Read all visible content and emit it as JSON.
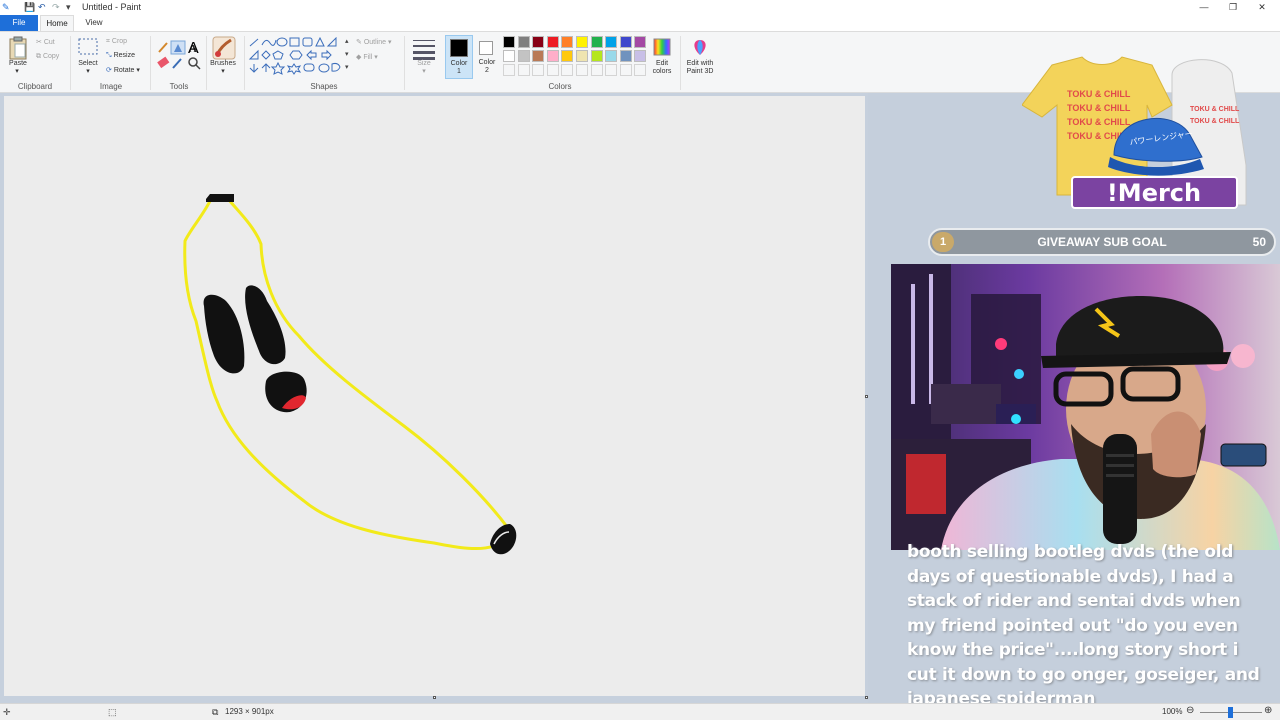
{
  "window": {
    "title": "Untitled - Paint",
    "controls": {
      "minimize": "—",
      "restore": "❐",
      "close": "✕"
    }
  },
  "menu": {
    "tabs": [
      "File",
      "Home",
      "View"
    ]
  },
  "ribbon": {
    "clipboard": {
      "label": "Clipboard",
      "paste": "Paste",
      "cut": "Cut",
      "copy": "Copy"
    },
    "image": {
      "label": "Image",
      "select": "Select",
      "crop": "Crop",
      "resize": "Resize",
      "rotate": "Rotate"
    },
    "tools": {
      "label": "Tools",
      "text_tool": "A"
    },
    "brushes": {
      "label": "Brushes"
    },
    "shapes": {
      "label": "Shapes",
      "outline": "Outline",
      "fill": "Fill"
    },
    "size": {
      "label": "Size"
    },
    "color1": {
      "label_a": "Color",
      "label_b": "1",
      "value": "#000000"
    },
    "color2": {
      "label_a": "Color",
      "label_b": "2",
      "value": "#ffffff"
    },
    "colors": {
      "label": "Colors",
      "palette_row1": [
        "#000000",
        "#7f7f7f",
        "#880015",
        "#ed1c24",
        "#ff7f27",
        "#fff200",
        "#22b14c",
        "#00a2e8",
        "#3f48cc",
        "#a349a4"
      ],
      "palette_row2": [
        "#ffffff",
        "#c3c3c3",
        "#b97a57",
        "#ffaec9",
        "#ffc90e",
        "#efe4b0",
        "#b5e61d",
        "#99d9ea",
        "#7092be",
        "#c8bfe7"
      ],
      "edit_colors_a": "Edit",
      "edit_colors_b": "colors"
    },
    "paint3d": {
      "label_a": "Edit with",
      "label_b": "Paint 3D"
    }
  },
  "status": {
    "dimensions": "1293 × 901px",
    "zoom": "100%"
  },
  "overlay": {
    "merch": {
      "label": "!Merch",
      "shirt_text": "TOKU & CHILL",
      "cap_text": "パワーレンジャー"
    },
    "sub_goal": {
      "title": "GIVEAWAY SUB GOAL",
      "current": "1",
      "target": "50"
    },
    "chat_message": "booth selling bootleg dvds (the old days of questionable dvds), I had a stack of rider and sentai dvds when my friend pointed out \"do you even know the price\"....long story short i cut it down to go onger, goseiger, and japanese spiderman"
  },
  "colors": {
    "file_tab": "#1e6fd9",
    "canvas": "#ececec",
    "workspace": "#c6d0dd",
    "drawing_yellow": "#f2ea1a",
    "drawing_red": "#e1272f"
  }
}
